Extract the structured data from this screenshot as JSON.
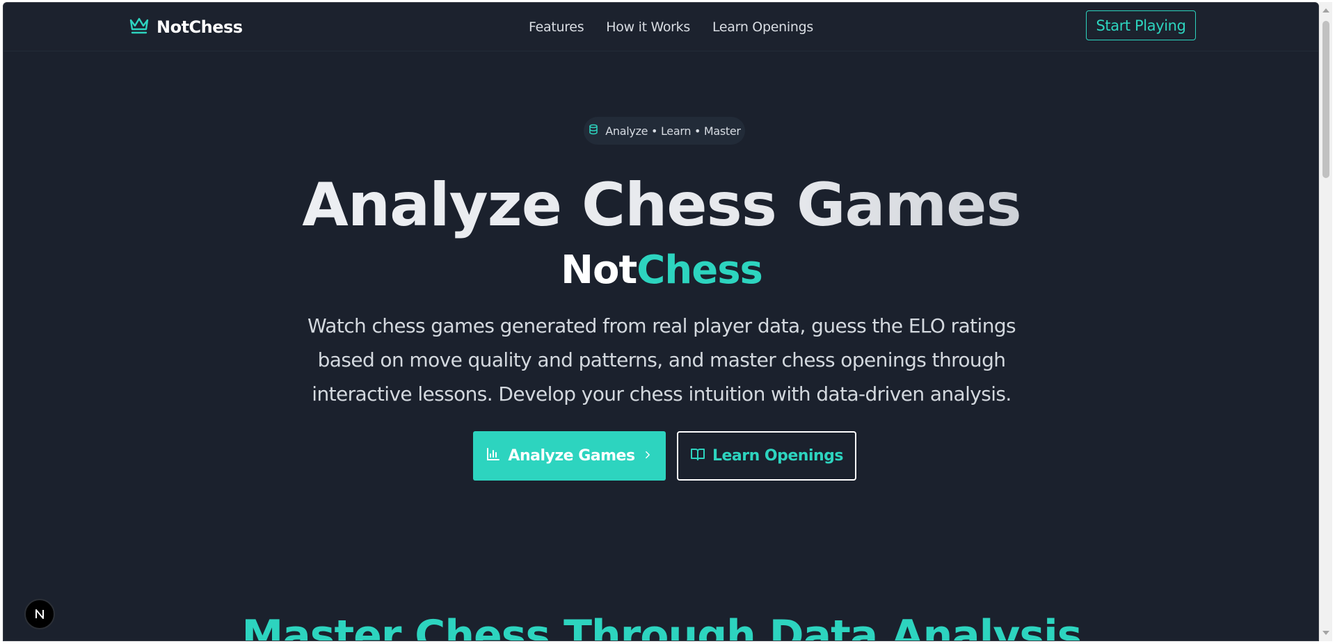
{
  "brand": {
    "name": "NotChess",
    "icon": "crown-icon"
  },
  "nav": {
    "links": [
      "Features",
      "How it Works",
      "Learn Openings"
    ],
    "cta": "Start Playing"
  },
  "hero": {
    "pill": {
      "icon": "database-icon",
      "text": "Analyze • Learn • Master"
    },
    "title": "Analyze Chess Games",
    "brand_part1": "Not",
    "brand_part2": "Chess",
    "description": "Watch chess games generated from real player data, guess the ELO ratings based on move quality and patterns, and master chess openings through interactive lessons. Develop your chess intuition with data-driven analysis.",
    "primary_button": {
      "label": "Analyze Games",
      "icon": "bar-chart-icon",
      "trailing_icon": "chevron-right-icon"
    },
    "secondary_button": {
      "label": "Learn Openings",
      "icon": "book-open-icon"
    }
  },
  "section": {
    "title": "Master Chess Through Data Analysis"
  },
  "dev_badge": {
    "letter": "N"
  },
  "colors": {
    "accent": "#2dd4bf",
    "background": "#1b212d",
    "text": "#d3d8de"
  }
}
